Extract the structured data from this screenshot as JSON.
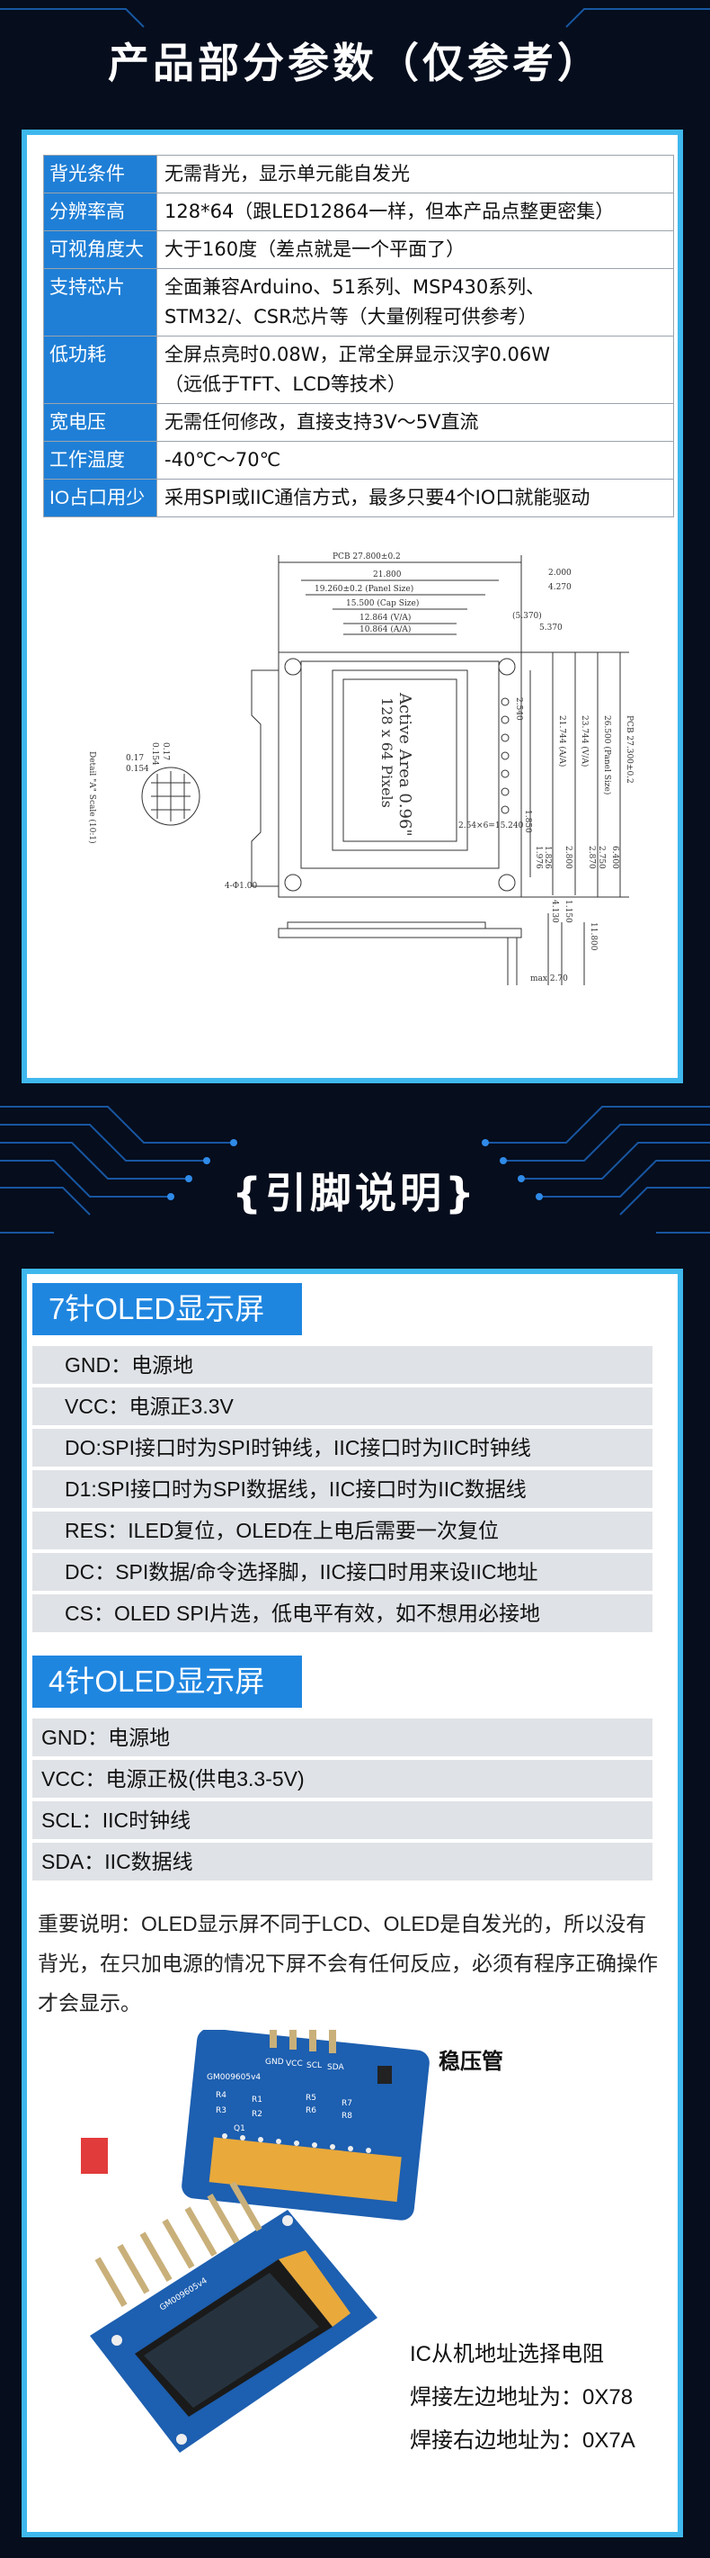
{
  "titles": {
    "params": "产品部分参数（仅参考）",
    "pins": "{引脚说明}"
  },
  "params": [
    {
      "key": "背光条件",
      "value": "无需背光，显示单元能自发光"
    },
    {
      "key": "分辨率高",
      "value": "128*64（跟LED12864一样，但本产品点整更密集）"
    },
    {
      "key": "可视角度大",
      "value": "大于160度（差点就是一个平面了）"
    },
    {
      "key": "支持芯片",
      "value": "全面兼容Arduino、51系列、MSP430系列、",
      "value2": "STM32/、CSR芯片等（大量例程可供参考）"
    },
    {
      "key": "低功耗",
      "value": "全屏点亮时0.08W，正常全屏显示汉字0.06W",
      "value2": "（远低于TFT、LCD等技术）"
    },
    {
      "key": "宽电压",
      "value": "无需任何修改，直接支持3V～5V直流"
    },
    {
      "key": "工作温度",
      "value": "-40℃～70℃"
    },
    {
      "key": "IO占口用少",
      "value": "采用SPI或IIC通信方式，最多只要4个IO口就能驱动"
    }
  ],
  "drawing": {
    "pcb_width": "PCB 27.800±0.2",
    "dim_21800": "21.800",
    "panel_size": "19.260±0.2 (Panel Size)",
    "cap_size": "15.500 (Cap Size)",
    "va": "12.864 (V/A)",
    "aa": "10.864 (A/A)",
    "dim_2000": "2.000",
    "dim_4270": "4.270",
    "dim_5370": "(5.370)",
    "dim_5370b": "5.370",
    "active_area": "Active Area 0.96\"",
    "pixels": "128 x 64 Pixels",
    "dim_017": "0.17",
    "dim_0154": "0.154",
    "dim_0154v": "0.154",
    "dim_017v": "0.17",
    "pixel_detail": "Detail \"A\" Scale (10:1)",
    "hole": "4-Φ1.00",
    "pcb_height": "PCB 27.300±0.2",
    "panel_h": "26.500 (Panel Size)",
    "dim_23744": "23.744 (V/A)",
    "dim_21744": "21.744 (A/A)",
    "dim_1976": "1.976",
    "dim_1826": "1.826",
    "dim_2800": "2.800",
    "dim_2870": "2.870",
    "dim_2540": "2.54×6=15.240",
    "dim_2540b": "2.540",
    "dim_4130": "4.130",
    "dim_1150": "1.150",
    "dim_1850": "1.850",
    "dim_2750": "2.750",
    "dim_6400": "6.400",
    "dim_1800": "11.800",
    "dim_max": "max 2.70"
  },
  "pins7": {
    "header": "7针OLED显示屏",
    "rows": [
      "GND：电源地",
      "VCC：电源正3.3V",
      "DO:SPI接口时为SPI时钟线，IIC接口时为IIC时钟线",
      "D1:SPI接口时为SPI数据线，IIC接口时为IIC数据线",
      "RES：ILED复位，OLED在上电后需要一次复位",
      "DC：SPI数据/命令选择脚，IIC接口时用来设IIC地址",
      "CS：OLED SPI片选，低电平有效，如不想用必接地"
    ]
  },
  "pins4": {
    "header": "4针OLED显示屏",
    "rows": [
      "GND：电源地",
      "VCC：电源正极(供电3.3-5V)",
      "SCL：IIC时钟线",
      "SDA：IIC数据线"
    ]
  },
  "note": "重要说明：OLED显示屏不同于LCD、OLED是自发光的，所以没有背光，在只加电源的情况下屏不会有任何反应，必须有程序正确操作才会显示。",
  "photo": {
    "regulator_label": "稳压管",
    "addr_title": "IC从机地址选择电阻",
    "addr_left": "焊接左边地址为：0X78",
    "addr_right": "焊接右边地址为：0X7A",
    "board_text_1": "GM009605v4",
    "board_text_2": "GM009605v4",
    "pin_labels": [
      "GND",
      "VCC",
      "SCL",
      "SDA"
    ],
    "resistor_labels": [
      "R4",
      "R1",
      "R3",
      "R2",
      "R5",
      "R6",
      "R7",
      "R8",
      "Q1"
    ]
  },
  "colors": {
    "accent": "#1f86e0",
    "panel_border": "#3fb8ee",
    "background": "#060d1d"
  }
}
